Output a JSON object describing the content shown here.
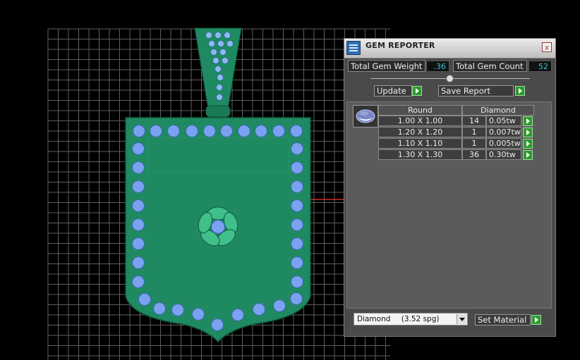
{
  "panel": {
    "title": "GEM REPORTER",
    "close_glyph": "x",
    "icon": "gem-reporter-icon"
  },
  "stats": {
    "total_weight_label": "Total Gem Weight",
    "total_weight_value": ".36",
    "total_count_label": "Total Gem Count",
    "total_count_value": "52"
  },
  "buttons": {
    "update": "Update",
    "save_report": "Save Report",
    "set_material": "Set Material"
  },
  "gem_table": {
    "shape_header": "Round",
    "material_header": "Diamond",
    "rows": [
      {
        "size": "1.00 X 1.00",
        "count": "14",
        "weight": "0.05tw"
      },
      {
        "size": "1.20 X 1.20",
        "count": "1",
        "weight": "0.007tw"
      },
      {
        "size": "1.10 X 1.10",
        "count": "1",
        "weight": "0.005tw"
      },
      {
        "size": "1.30 X 1.30",
        "count": "36",
        "weight": "0.30tw"
      }
    ]
  },
  "material_select": {
    "value": "Diamond",
    "spg": "(3.52 spg)"
  },
  "colors": {
    "metal_green": "#1f8a61",
    "gem_blue": "#7aa2f0",
    "value_cyan": "#33c6d8",
    "arrow_green": "#2f9a2f"
  }
}
